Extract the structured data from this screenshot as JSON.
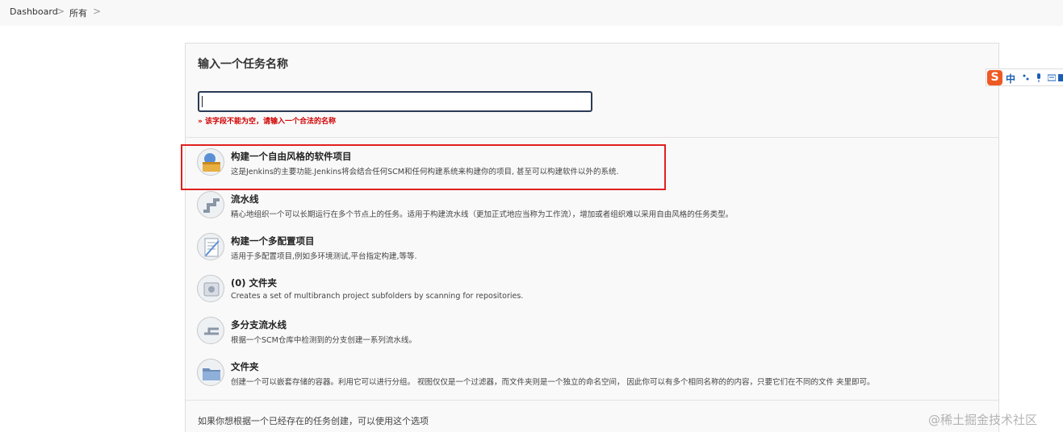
{
  "breadcrumb": {
    "items": [
      "Dashboard",
      "所有"
    ],
    "separator": ">"
  },
  "form": {
    "title": "输入一个任务名称",
    "input_value": "",
    "error": "» 该字段不能为空，请输入一个合法的名称"
  },
  "job_types": [
    {
      "title": "构建一个自由风格的软件项目",
      "desc": "这是Jenkins的主要功能.Jenkins将会结合任何SCM和任何构建系统来构建你的项目, 甚至可以构建软件以外的系统.",
      "icon": "freestyle-project-icon"
    },
    {
      "title": "流水线",
      "desc": "精心地组织一个可以长期运行在多个节点上的任务。适用于构建流水线（更加正式地应当称为工作流），增加或者组织难以采用自由风格的任务类型。",
      "icon": "pipeline-icon"
    },
    {
      "title": "构建一个多配置项目",
      "desc": "适用于多配置项目,例如多环境测试,平台指定构建,等等.",
      "icon": "multi-config-icon"
    },
    {
      "title": "(0) 文件夹",
      "desc": "Creates a set of multibranch project subfolders by scanning for repositories.",
      "icon": "org-folder-icon"
    },
    {
      "title": "多分支流水线",
      "desc": "根据一个SCM仓库中检测到的分支创建一系列流水线。",
      "icon": "multibranch-pipeline-icon"
    },
    {
      "title": "文件夹",
      "desc": "创建一个可以嵌套存储的容器。利用它可以进行分组。 视图仅仅是一个过滤器，而文件夹则是一个独立的命名空间， 因此你可以有多个相同名称的的内容，只要它们在不同的文件 夹里即可。",
      "icon": "folder-icon"
    }
  ],
  "copy_section": {
    "text": "如果你想根据一个已经存在的任务创建，可以使用这个选项"
  },
  "ime": {
    "logo": "S",
    "lang": "中"
  },
  "watermark": "@稀土掘金技术社区",
  "colors": {
    "highlight": "#e02020",
    "error": "#d10000",
    "input_border": "#2b3a55"
  }
}
